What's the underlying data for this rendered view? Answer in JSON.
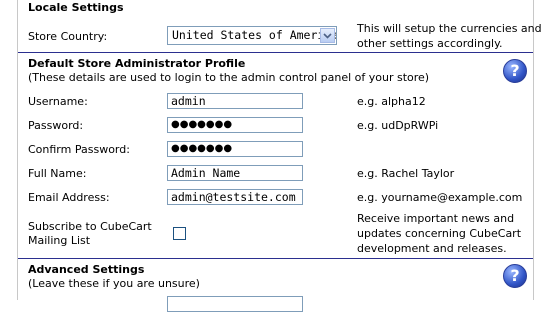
{
  "locale": {
    "heading": "Locale Settings",
    "store_country_label": "Store Country:",
    "store_country_value": "United States of America",
    "note_line1": "This will setup the currencies and",
    "note_line2": "other settings accordingly."
  },
  "admin": {
    "heading": "Default Store Administrator Profile",
    "subheading": "(These details are used to login to the admin control panel of your store)",
    "help_label": "?",
    "fields": [
      {
        "label": "Username:",
        "value": "admin",
        "example": "e.g. alpha12"
      },
      {
        "label": "Password:",
        "value": "●●●●●●●",
        "example": "e.g. udDpRWPi"
      },
      {
        "label": "Confirm Password:",
        "value": "●●●●●●●",
        "example": ""
      },
      {
        "label": "Full Name:",
        "value": "Admin Name",
        "example": "e.g. Rachel Taylor"
      },
      {
        "label": "Email Address:",
        "value": "admin@testsite.com",
        "example": "e.g. yourname@example.com"
      }
    ],
    "subscribe_label_line1": "Subscribe to CubeCart",
    "subscribe_label_line2": "Mailing List",
    "subscribe_checked": false,
    "subscribe_note_line1": "Receive important news and",
    "subscribe_note_line2": "updates concerning CubeCart",
    "subscribe_note_line3": "development and releases."
  },
  "advanced": {
    "heading": "Advanced Settings",
    "subheading": "(Leave these if you are unsure)",
    "help_label": "?"
  },
  "colors": {
    "separator": "#2b2f8f",
    "input_border": "#7f9db9",
    "help_icon": "#3155c7"
  }
}
